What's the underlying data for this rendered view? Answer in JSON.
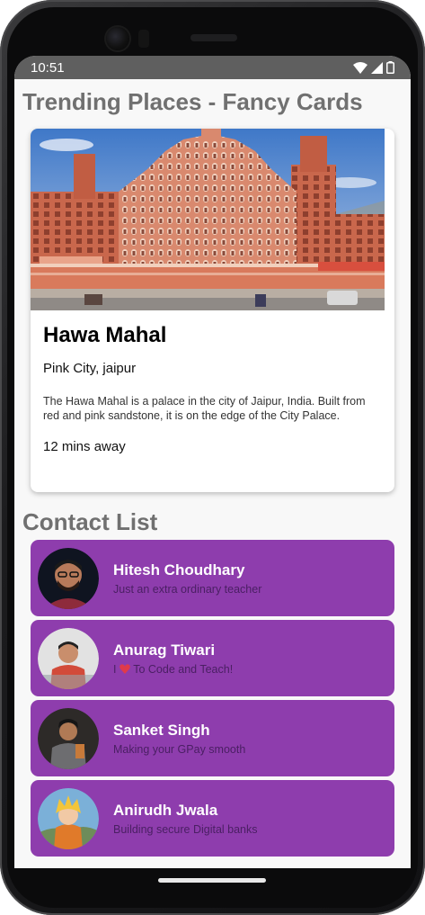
{
  "status": {
    "time": "10:51"
  },
  "trending": {
    "title": "Trending Places - Fancy Cards",
    "card": {
      "name": "Hawa Mahal",
      "location": "Pink City, jaipur",
      "description": "The Hawa Mahal is a palace in the city of Jaipur, India. Built from red and pink sandstone, it is on the edge of the City Palace.",
      "distance": "12 mins away"
    }
  },
  "contacts": {
    "title": "Contact List",
    "items": [
      {
        "name": "Hitesh Choudhary",
        "status": "Just an extra ordinary teacher"
      },
      {
        "name": "Anurag Tiwari",
        "status_pre": "I",
        "status_post": "To Code and Teach!"
      },
      {
        "name": "Sanket Singh",
        "status": "Making your GPay smooth"
      },
      {
        "name": "Anirudh Jwala",
        "status": "Building secure Digital banks"
      }
    ]
  },
  "colors": {
    "contact_bg": "#8e3dad",
    "status_bar": "#5f5f5f",
    "title_gray": "#707070"
  }
}
